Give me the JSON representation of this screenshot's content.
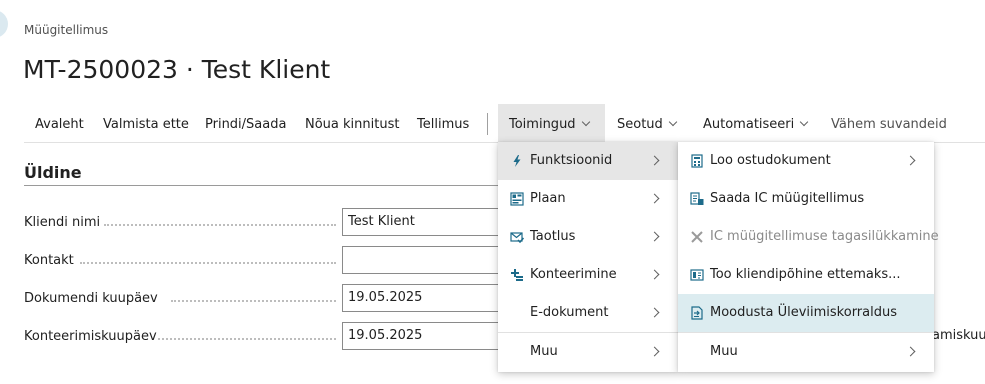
{
  "breadcrumb": "Müügitellimus",
  "page_title": "MT-2500023 · Test Klient",
  "action_bar": {
    "items": [
      "Avaleht",
      "Valmista ette",
      "Prindi/Saada",
      "Nõua kinnitust",
      "Tellimus"
    ],
    "dropdowns": [
      "Toimingud",
      "Seotud",
      "Automatiseeri"
    ],
    "less_options": "Vähem suvandeid"
  },
  "section": {
    "title": "Üldine",
    "fields": [
      {
        "label": "Kliendi nimi",
        "value": "Test Klient"
      },
      {
        "label": "Kontakt",
        "value": ""
      },
      {
        "label": "Dokumendi kuupäev",
        "value": "19.05.2025"
      },
      {
        "label": "Konteerimiskuupäev",
        "value": "19.05.2025"
      }
    ]
  },
  "right_edge_text": "amiskuu",
  "menu_primary": {
    "items": [
      {
        "label": "Funktsioonid",
        "icon": "lightning-icon"
      },
      {
        "label": "Plaan",
        "icon": "plan-grid-icon"
      },
      {
        "label": "Taotlus",
        "icon": "request-envelope-icon"
      },
      {
        "label": "Konteerimine",
        "icon": "posting-icon"
      },
      {
        "label": "E-dokument",
        "icon": ""
      },
      {
        "label": "Muu",
        "icon": ""
      }
    ]
  },
  "menu_functions": {
    "items": [
      {
        "label": "Loo ostudokument",
        "icon": "document-calculator-icon"
      },
      {
        "label": "Saada IC müügitellimus",
        "icon": "document-send-icon"
      },
      {
        "label": "IC müügitellimuse tagasilükkamine",
        "icon": "close-icon"
      },
      {
        "label": "Too kliendipõhine ettemaks...",
        "icon": "prepayment-icon"
      },
      {
        "label": "Moodusta Üleviimiskorraldus",
        "icon": "transfer-document-icon"
      },
      {
        "label": "Muu",
        "icon": ""
      }
    ]
  },
  "colors": {
    "accent_icon": "#1d6b8a",
    "hover_bg": "#e6e6e6",
    "selected_bg": "#dcecf0"
  }
}
